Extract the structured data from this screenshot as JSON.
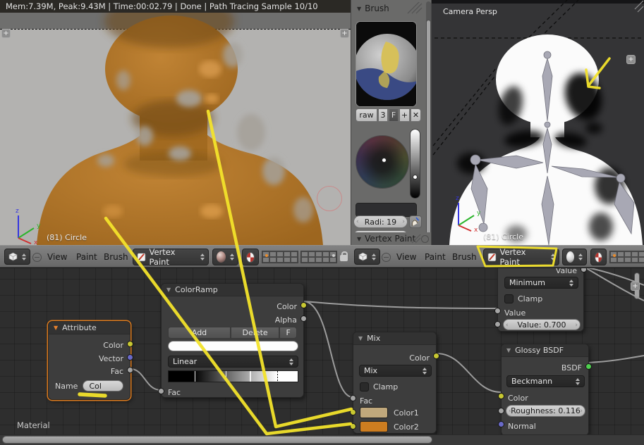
{
  "glyphs": {
    "triangle": "▼",
    "plus": "+",
    "close": "✕"
  },
  "colors": {
    "annotation": "#f3e32b",
    "mix_color1": "#c0a87c",
    "mix_color2": "#cd7d20",
    "selected_node_outline": "#dd7b1e",
    "socket_yellow": "#c8c832",
    "socket_gray": "#a5a5a5",
    "socket_vector": "#6a6ac8",
    "socket_shader": "#4fd04f"
  },
  "info_bar": {
    "status": "Mem:7.39M, Peak:9.43M | Time:00:02.79 | Done | Path Tracing Sample 10/10"
  },
  "left_viewport": {
    "object_info": "(81) Circle",
    "axis_x": "x",
    "axis_y": "y",
    "axis_z": "z",
    "header": {
      "view": "View",
      "paint": "Paint",
      "brush": "Brush",
      "mode": "Vertex Paint"
    }
  },
  "right_viewport": {
    "view_label": "Camera Persp",
    "object_info": "(81) Circle",
    "axis_x": "x",
    "axis_y": "y",
    "axis_z": "z",
    "header": {
      "view": "View",
      "paint": "Paint",
      "brush": "Brush",
      "mode": "Vertex Paint"
    }
  },
  "brush_panel": {
    "title": "Brush",
    "datablock_name": "raw",
    "users_count": "3",
    "fake_user": "F",
    "radius_slider": "Radi: 19",
    "vertex_paint_title": "Vertex Paint"
  },
  "node_editor": {
    "breadcrumb": "Material",
    "attribute": {
      "title": "Attribute",
      "out_color": "Color",
      "out_vector": "Vector",
      "out_fac": "Fac",
      "name_label": "Name",
      "name_value": "Col"
    },
    "colorramp": {
      "title": "ColorRamp",
      "out_color": "Color",
      "out_alpha": "Alpha",
      "add": "Add",
      "delete": "Delete",
      "fake_user": "F",
      "interpolation": "Linear",
      "in_fac": "Fac"
    },
    "mix": {
      "title": "Mix",
      "out_color": "Color",
      "blend_mode": "Mix",
      "clamp": "Clamp",
      "in_fac": "Fac",
      "in_color1": "Color1",
      "in_color2": "Color2"
    },
    "glossy": {
      "title": "Glossy BSDF",
      "out_bsdf": "BSDF",
      "distribution": "Beckmann",
      "in_color": "Color",
      "roughness": "Roughness: 0.116",
      "in_normal": "Normal"
    },
    "math": {
      "operation": "Minimum",
      "clamp": "Clamp",
      "in_value": "Value",
      "in_value_2": "Value: 0.700"
    }
  }
}
